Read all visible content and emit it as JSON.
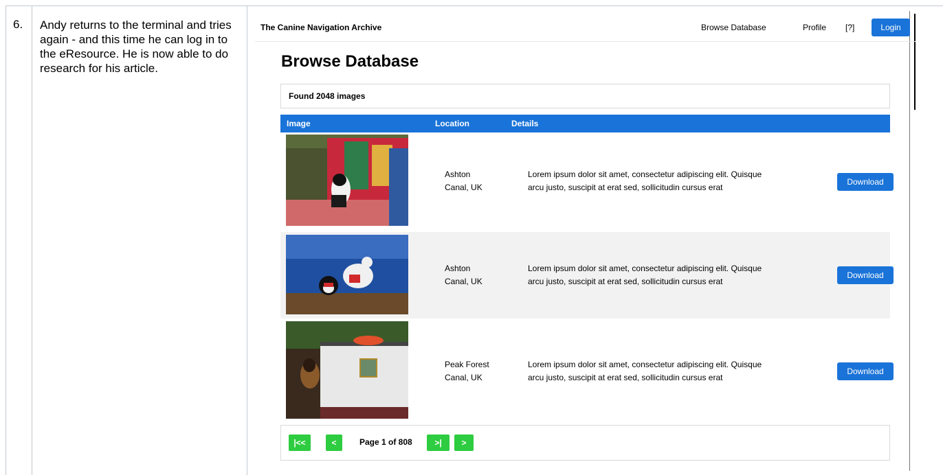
{
  "step": {
    "number": "6.",
    "text": "Andy returns to the terminal and tries again - and this time he can log in to the eResource. He is now able to do research for his article."
  },
  "app": {
    "brand": "The Canine Navigation Archive",
    "nav": {
      "browse": "Browse Database",
      "profile": "Profile",
      "help": "[?]",
      "login": "Login"
    },
    "page_title": "Browse Database",
    "found": "Found 2048 images",
    "table": {
      "headers": {
        "image": "Image",
        "location": "Location",
        "details": "Details"
      },
      "rows": [
        {
          "location_line1": "Ashton",
          "location_line2": "Canal, UK",
          "details_line1": "Lorem ipsum dolor sit amet, consectetur adipiscing elit. Quisque",
          "details_line2": "arcu justo, suscipit at erat sed, sollicitudin cursus erat",
          "download": "Download"
        },
        {
          "location_line1": "Ashton",
          "location_line2": "Canal, UK",
          "details_line1": "Lorem ipsum dolor sit amet, consectetur adipiscing elit. Quisque",
          "details_line2": "arcu justo, suscipit at erat sed, sollicitudin cursus erat",
          "download": "Download"
        },
        {
          "location_line1": "Peak Forest",
          "location_line2": "Canal, UK",
          "details_line1": "Lorem ipsum dolor sit amet, consectetur adipiscing elit. Quisque",
          "details_line2": "arcu justo, suscipit at erat sed, sollicitudin cursus erat",
          "download": "Download"
        }
      ]
    },
    "pager": {
      "first": "|<<",
      "prev": "<",
      "label": "Page 1 of 808",
      "last": ">|",
      "next": ">"
    }
  },
  "colors": {
    "primary": "#1a73d8",
    "pager_green": "#2ecc40",
    "alt_row": "#f2f2f2"
  }
}
